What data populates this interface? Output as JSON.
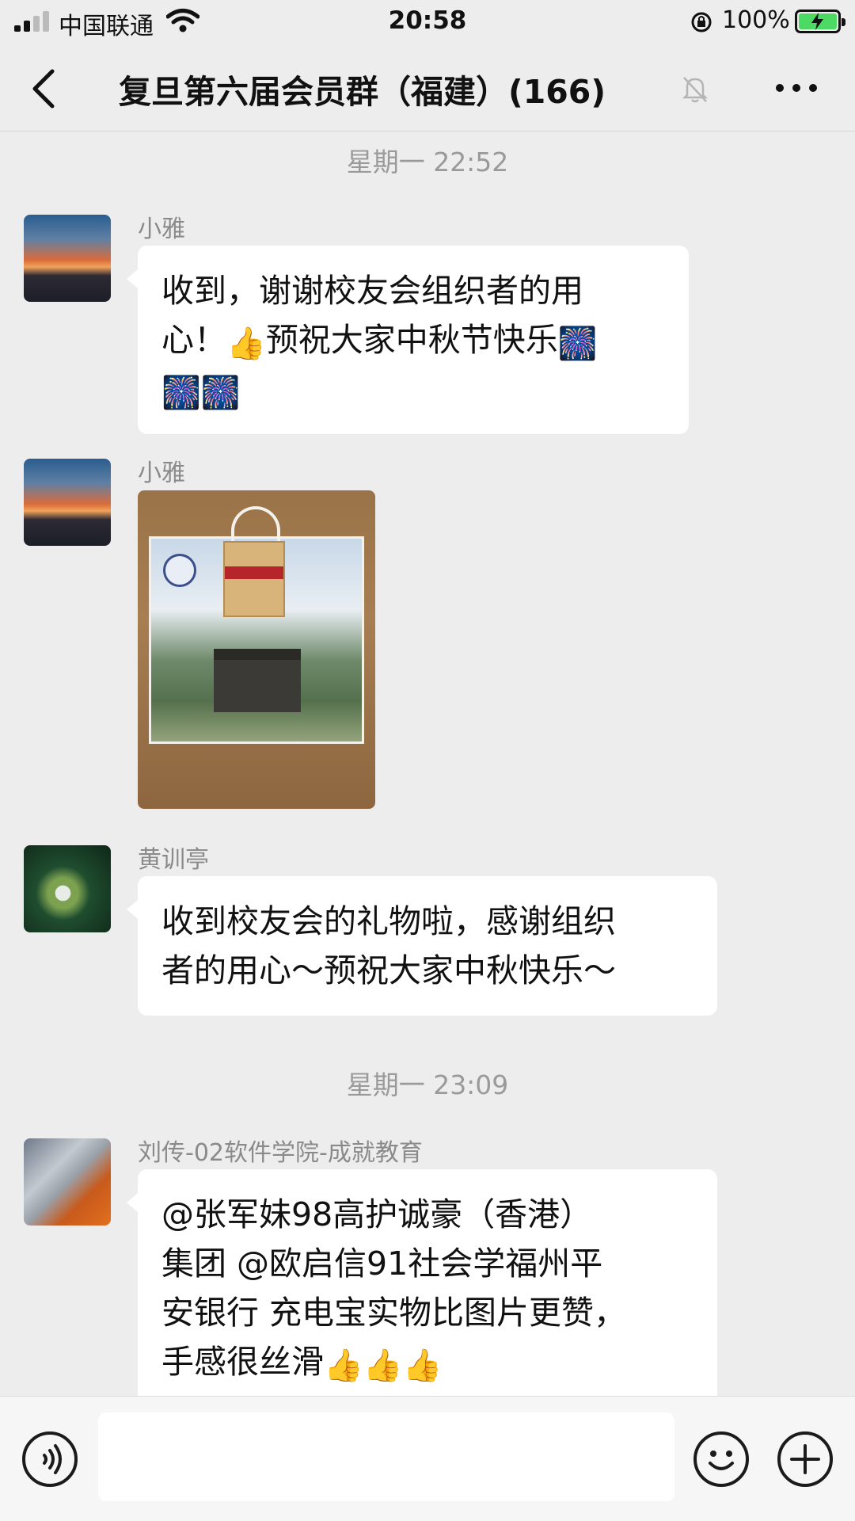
{
  "status_bar": {
    "carrier": "中国联通",
    "time": "20:58",
    "battery": "100%"
  },
  "nav": {
    "title": "复旦第六届会员群（福建）(166)"
  },
  "chat": {
    "timestamps": [
      "星期一 22:52",
      "星期一 23:09"
    ],
    "messages": [
      {
        "sender": "小雅",
        "line1": "收到，谢谢校友会组织者的用",
        "line2a": "心！",
        "line2b": "预祝大家中秋节快乐"
      },
      {
        "sender": "小雅"
      },
      {
        "sender": "黄训亭",
        "line1": "收到校友会的礼物啦，感谢组织",
        "line2": "者的用心～预祝大家中秋快乐～"
      },
      {
        "sender": "刘传-02软件学院-成就教育",
        "line1": "@张军妹98高护诚豪（香港）",
        "line2": "集团 @欧启信91社会学福州平",
        "line3": "安银行 充电宝实物比图片更赞，",
        "line4": "手感很丝滑"
      }
    ]
  },
  "emoji": {
    "thumbs_up": "👍",
    "fireworks": "🎆"
  },
  "input": {
    "value": ""
  }
}
